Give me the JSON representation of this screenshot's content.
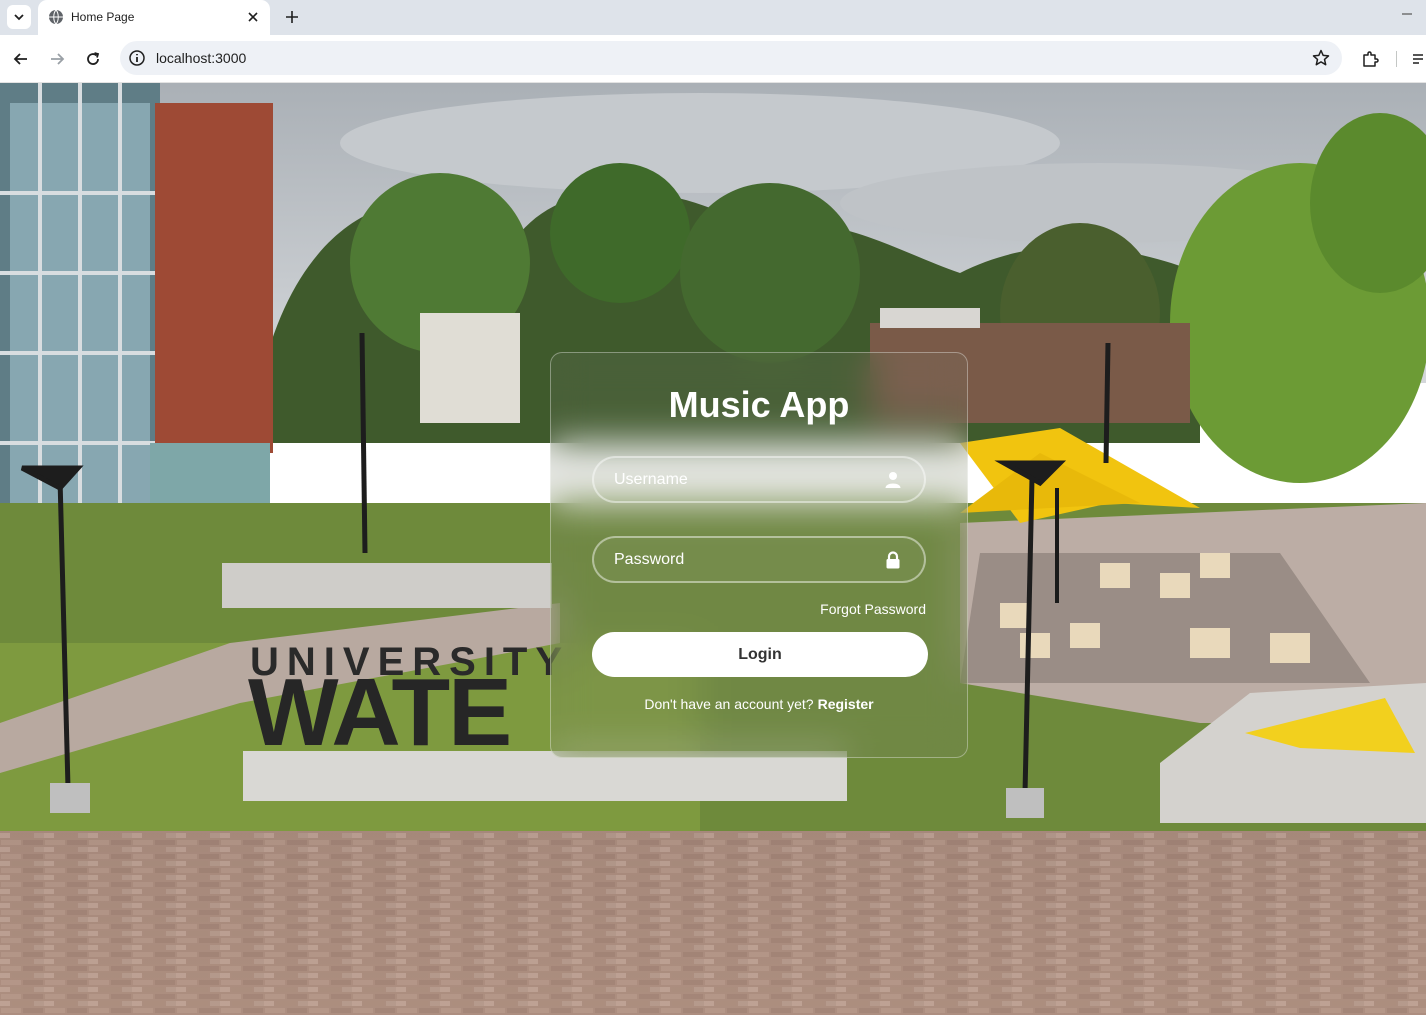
{
  "browser": {
    "tab": {
      "title": "Home Page"
    },
    "address_bar": {
      "url": "localhost:3000"
    }
  },
  "page": {
    "background_sign": {
      "line1": "UNIVERSITY",
      "line2": "WATE"
    },
    "login": {
      "title": "Music App",
      "username_placeholder": "Username",
      "password_placeholder": "Password",
      "forgot_password": "Forgot Password",
      "login_button": "Login",
      "register_prompt": "Don't have an account yet?",
      "register_link": "Register"
    }
  },
  "icons": {
    "tab_favicon": "globe-icon",
    "username_field": "user-icon",
    "password_field": "lock-icon"
  },
  "colors": {
    "login_button_bg": "#ffffff",
    "accent_yellow": "#f1c40f"
  }
}
